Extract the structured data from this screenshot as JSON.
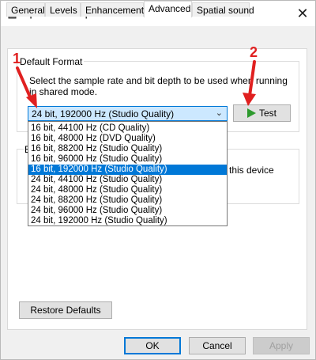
{
  "window": {
    "title": "Speakers Properties",
    "close_glyph": "✕"
  },
  "tabs": [
    {
      "label": "General"
    },
    {
      "label": "Levels"
    },
    {
      "label": "Enhancements"
    },
    {
      "label": "Advanced"
    },
    {
      "label": "Spatial sound"
    }
  ],
  "default_format": {
    "title": "Default Format",
    "description": "Select the sample rate and bit depth to be used when running in shared mode.",
    "selected": "24 bit, 192000 Hz (Studio Quality)",
    "test_label": "Test",
    "options": [
      {
        "label": "16 bit, 44100 Hz (CD Quality)"
      },
      {
        "label": "16 bit, 48000 Hz (DVD Quality)"
      },
      {
        "label": "16 bit, 88200 Hz (Studio Quality)"
      },
      {
        "label": "16 bit, 96000 Hz (Studio Quality)"
      },
      {
        "label": "16 bit, 192000 Hz (Studio Quality)"
      },
      {
        "label": "24 bit, 44100 Hz (Studio Quality)"
      },
      {
        "label": "24 bit, 48000 Hz (Studio Quality)"
      },
      {
        "label": "24 bit, 88200 Hz (Studio Quality)"
      },
      {
        "label": "24 bit, 96000 Hz (Studio Quality)"
      },
      {
        "label": "24 bit, 192000 Hz (Studio Quality)"
      }
    ],
    "highlighted_option_index": 4
  },
  "exclusive_mode": {
    "partial_letter": "E",
    "partial_text": "this device"
  },
  "restore_label": "Restore Defaults",
  "footer": {
    "ok": "OK",
    "cancel": "Cancel",
    "apply": "Apply"
  },
  "annotations": {
    "one": "1",
    "two": "2"
  },
  "colors": {
    "accent": "#0078d7",
    "annotation": "#e02020",
    "play": "#2e9a2e"
  },
  "icons": {
    "app": "speaker-icon",
    "close": "close-icon",
    "dropdown": "chevron-down-icon",
    "test": "play-icon"
  }
}
